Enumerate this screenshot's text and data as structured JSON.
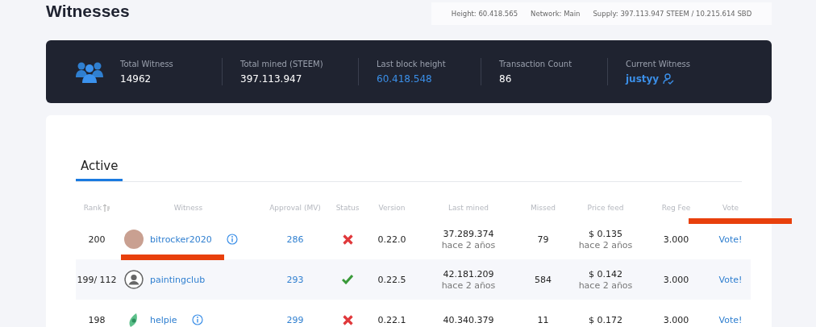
{
  "page": {
    "title": "Witnesses"
  },
  "info_bar": [
    "Height: 60.418.565",
    "Network: Main",
    "Supply: 397.113.947 STEEM / 10.215.614 SBD"
  ],
  "stats": [
    {
      "label": "Total Witness",
      "value": "14962",
      "kind": "plain"
    },
    {
      "label": "Total mined (STEEM)",
      "value": "397.113.947",
      "kind": "plain"
    },
    {
      "label": "Last block height",
      "value": "60.418.548",
      "kind": "link"
    },
    {
      "label": "Transaction Count",
      "value": "86",
      "kind": "plain"
    },
    {
      "label": "Current Witness",
      "value": "justyy",
      "kind": "user"
    }
  ],
  "tabs": [
    {
      "label": "Active",
      "selected": true
    }
  ],
  "table": {
    "columns": [
      "Rank",
      "Witness",
      "Approval (MV)",
      "Status",
      "Version",
      "Last mined",
      "Missed",
      "Price feed",
      "Reg Fee",
      "Vote"
    ],
    "rows": [
      {
        "rank": "200",
        "avatar": {
          "kind": "photo"
        },
        "witness": "bitrocker2020",
        "info": true,
        "approval": "286",
        "status_ok": false,
        "version": "0.22.0",
        "last_mined": "37.289.374",
        "last_mined_ago": "hace 2 años",
        "missed": "79",
        "price": "$ 0.135",
        "price_ago": "hace 2 años",
        "reg_fee": "3.000",
        "vote": "Vote!"
      },
      {
        "rank": "199/ 112",
        "avatar": {
          "kind": "default"
        },
        "witness": "paintingclub",
        "info": false,
        "approval": "293",
        "status_ok": true,
        "version": "0.22.5",
        "last_mined": "42.181.209",
        "last_mined_ago": "hace 2 años",
        "missed": "584",
        "price": "$ 0.142",
        "price_ago": "hace 2 años",
        "reg_fee": "3.000",
        "vote": "Vote!"
      },
      {
        "rank": "198",
        "avatar": {
          "kind": "leaf"
        },
        "witness": "helpie",
        "info": true,
        "approval": "299",
        "status_ok": false,
        "version": "0.22.1",
        "last_mined": "40.340.379",
        "missed": "11",
        "price": "$ 0.172",
        "reg_fee": "3.000",
        "vote": "Vote!"
      }
    ]
  }
}
